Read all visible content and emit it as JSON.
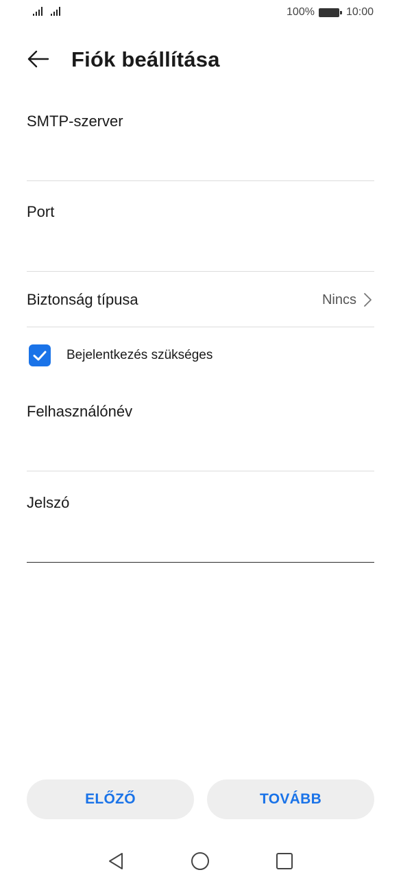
{
  "status_bar": {
    "battery_percent": "100%",
    "time": "10:00"
  },
  "header": {
    "back_icon": "arrow-left-icon",
    "title": "Fiók beállítása"
  },
  "form": {
    "smtp_server": {
      "label": "SMTP-szerver",
      "value": ""
    },
    "port": {
      "label": "Port",
      "value": ""
    },
    "security_type": {
      "label": "Biztonság típusa",
      "value": "Nincs"
    },
    "login_required": {
      "label": "Bejelentkezés szükséges",
      "checked": true
    },
    "username": {
      "label": "Felhasználónév",
      "value": ""
    },
    "password": {
      "label": "Jelszó",
      "value": ""
    }
  },
  "buttons": {
    "previous": "ELŐZŐ",
    "next": "TOVÁBB"
  },
  "colors": {
    "accent": "#1a73e8",
    "button_bg": "#eeeeee",
    "divider": "#dcdcdc"
  },
  "nav_bar": {
    "back_icon": "triangle-back-icon",
    "home_icon": "circle-home-icon",
    "recents_icon": "square-recents-icon"
  }
}
